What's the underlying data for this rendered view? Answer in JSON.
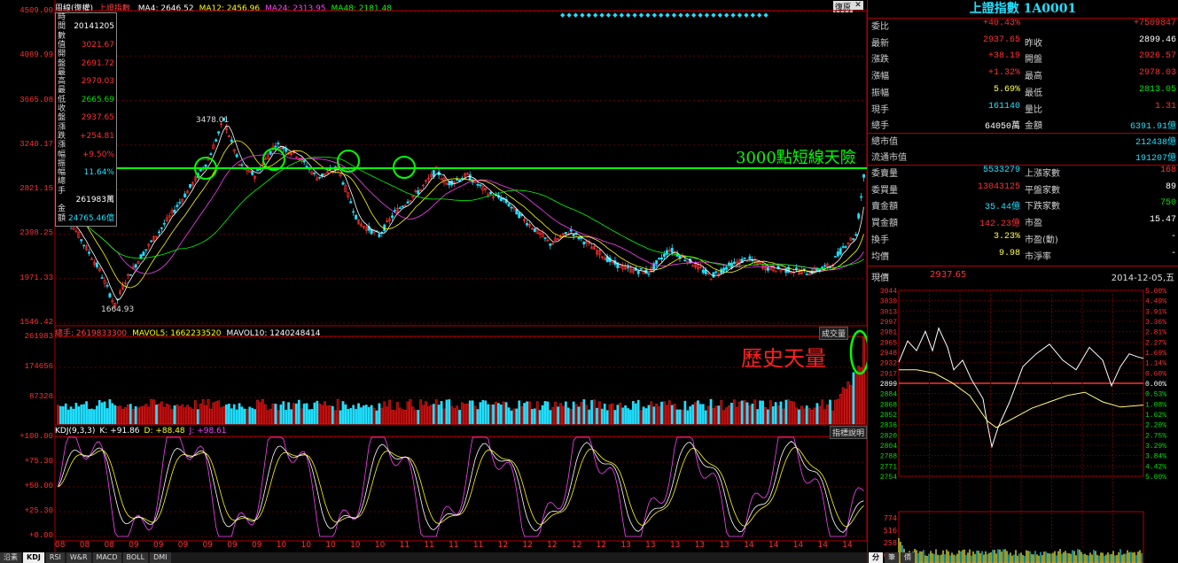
{
  "main_chart": {
    "title": "周線(復權)",
    "index_name": "上證指數",
    "ma": [
      {
        "label": "MA4: 2646.52",
        "color": "#ffffff"
      },
      {
        "label": "MA12: 2456.96",
        "color": "#ffff00"
      },
      {
        "label": "MA24: 2313.95",
        "color": "#ff40ff"
      },
      {
        "label": "MA48: 2181.48",
        "color": "#00ff00"
      }
    ],
    "y_ticks": [
      "4509.00",
      "4089.99",
      "3665.08",
      "3240.17",
      "2821.15",
      "2398.25",
      "1971.33",
      "1546.42"
    ],
    "high_label": "3478.01",
    "low_label": "1664.93",
    "annotation_line": "3000點短線天險",
    "restore_button": "復原",
    "info_box": [
      {
        "label": "時",
        "value": ""
      },
      {
        "label": "間",
        "value": "20141205"
      },
      {
        "label": "數",
        "value": ""
      },
      {
        "label": "值",
        "value": "3021.67"
      },
      {
        "label": "開",
        "value": ""
      },
      {
        "label": "盤",
        "value": "2691.72"
      },
      {
        "label": "最",
        "value": ""
      },
      {
        "label": "高",
        "value": "2970.03"
      },
      {
        "label": "最",
        "value": ""
      },
      {
        "label": "低",
        "value": "2665.69"
      },
      {
        "label": "收",
        "value": ""
      },
      {
        "label": "盤",
        "value": "2937.65"
      },
      {
        "label": "漲",
        "value": ""
      },
      {
        "label": "跌",
        "value": "+254.81"
      },
      {
        "label": "漲",
        "value": ""
      },
      {
        "label": "幅",
        "value": "+9.50%"
      },
      {
        "label": "振",
        "value": ""
      },
      {
        "label": "幅",
        "value": "11.64%"
      },
      {
        "label": "總",
        "value": ""
      },
      {
        "label": "手",
        "value": ""
      },
      {
        "label": "",
        "value": "261983萬"
      },
      {
        "label": "金",
        "value": ""
      },
      {
        "label": "額",
        "value": "24765.46億"
      }
    ]
  },
  "volume_chart": {
    "header": [
      {
        "label": "總手: 2619833300",
        "color": "#ff4040"
      },
      {
        "label": "MAVOL5: 1662233520",
        "color": "#ffff00"
      },
      {
        "label": "MAVOL10: 1240248414",
        "color": "#ffffff"
      }
    ],
    "y_ticks": [
      "261983",
      "174656",
      "87328"
    ],
    "button": "成交量",
    "annotation": "歷史天量"
  },
  "kdj_chart": {
    "header": [
      {
        "label": "KDJ(9,3,3)",
        "color": "#ffffff"
      },
      {
        "label": "K: +91.86",
        "color": "#ffffff"
      },
      {
        "label": "D: +88.48",
        "color": "#ffff00"
      },
      {
        "label": "J: +98.61",
        "color": "#ff40ff"
      }
    ],
    "y_ticks": [
      "+100.00",
      "+75.30",
      "+50.00",
      "+25.30",
      "+0.00"
    ],
    "button": "指標說明"
  },
  "x_axis": [
    "08",
    "08",
    "08",
    "09",
    "09",
    "09",
    "09",
    "09",
    "09",
    "10",
    "10",
    "10",
    "10",
    "10",
    "11",
    "11",
    "11",
    "11",
    "12",
    "12",
    "12",
    "12",
    "12",
    "13",
    "13",
    "13",
    "13",
    "13",
    "14",
    "14",
    "14",
    "14",
    "14"
  ],
  "bottom_tabs": [
    "沿素",
    "KDJ",
    "RSI",
    "W&R",
    "MACD",
    "BOLL",
    "DMI"
  ],
  "active_tab": "KDJ",
  "quote_panel": {
    "title": "上證指數 1A0001",
    "rows": [
      {
        "l1": "委比",
        "v1": "+40.43%",
        "c1": "red",
        "l2": "",
        "v2": "+7509847",
        "c2": "red"
      },
      {
        "l1": "最新",
        "v1": "2937.65",
        "c1": "red",
        "l2": "昨收",
        "v2": "2899.46",
        "c2": "wh"
      },
      {
        "l1": "漲跌",
        "v1": "+38.19",
        "c1": "red",
        "l2": "開盤",
        "v2": "2926.57",
        "c2": "red"
      },
      {
        "l1": "漲幅",
        "v1": "+1.32%",
        "c1": "red",
        "l2": "最高",
        "v2": "2978.03",
        "c2": "red"
      },
      {
        "l1": "振幅",
        "v1": "5.69%",
        "c1": "yl",
        "l2": "最低",
        "v2": "2813.05",
        "c2": "grn"
      },
      {
        "l1": "現手",
        "v1": "161140",
        "c1": "cy",
        "l2": "量比",
        "v2": "1.31",
        "c2": "red"
      },
      {
        "l1": "總手",
        "v1": "64050萬",
        "c1": "wh",
        "l2": "金額",
        "v2": "6391.91億",
        "c2": "cy"
      }
    ],
    "market_rows": [
      {
        "label": "總市值",
        "value": "212438億"
      },
      {
        "label": "流通市值",
        "value": "191207億"
      }
    ],
    "breadth_rows": [
      {
        "l1": "委賣量",
        "v1": "5533279",
        "c1": "cy",
        "l2": "上漲家數",
        "v2": "168",
        "c2": "red"
      },
      {
        "l1": "委買量",
        "v1": "13043125",
        "c1": "red",
        "l2": "平盤家數",
        "v2": "89",
        "c2": "wh"
      },
      {
        "l1": "賣金額",
        "v1": "35.44億",
        "c1": "cy",
        "l2": "下跌家數",
        "v2": "750",
        "c2": "grn"
      },
      {
        "l1": "買金額",
        "v1": "142.23億",
        "c1": "red",
        "l2": "市盈",
        "v2": "15.47",
        "c2": "wh"
      },
      {
        "l1": "換手",
        "v1": "3.23%",
        "c1": "yl",
        "l2": "市盈(動)",
        "v2": "-",
        "c2": "wh"
      },
      {
        "l1": "均價",
        "v1": "9.98",
        "c1": "yl",
        "l2": "市淨率",
        "v2": "-",
        "c2": "wh"
      }
    ],
    "price_label": "現價",
    "price_value": "2937.65",
    "date": "2014-12-05,五"
  },
  "intraday": {
    "left_ticks": [
      "3044",
      "3030",
      "3013",
      "2997",
      "2981",
      "2965",
      "2948",
      "2932",
      "2917",
      "2899",
      "2884",
      "2868",
      "2852",
      "2836",
      "2820",
      "2804",
      "2788",
      "2771",
      "2754"
    ],
    "right_ticks": [
      "5.00%",
      "4.49%",
      "3.91%",
      "3.36%",
      "2.81%",
      "2.27%",
      "1.69%",
      "1.14%",
      "0.60%",
      "0.00%",
      "0.53%",
      "1.08%",
      "1.62%",
      "2.20%",
      "2.75%",
      "3.29%",
      "3.84%",
      "4.42%",
      "5.00%"
    ],
    "vol_ticks": [
      "774",
      "516",
      "258",
      "X10000"
    ],
    "bottom_tabs": [
      "分",
      "筆",
      "價"
    ]
  },
  "colors": {
    "up": "#ff3030",
    "down": "#20e0ff",
    "grid": "#b00000",
    "annotation": "#00ff00"
  }
}
